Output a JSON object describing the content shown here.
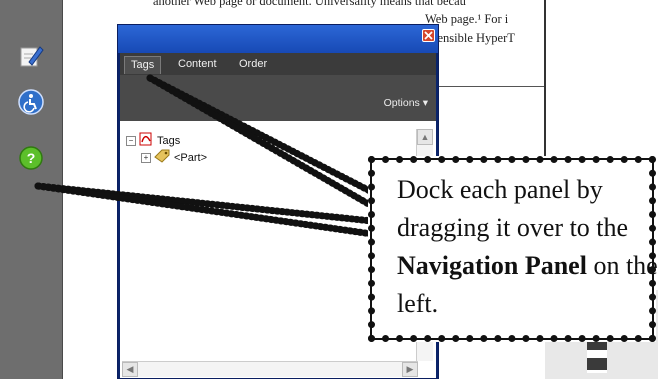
{
  "document": {
    "line1": "another Web page or document. Universality means that becau",
    "line2": "Web page.¹  For i",
    "line3": "Xtensible HyperT"
  },
  "nav_panel": {
    "buttons": [
      {
        "icon": "pen-edit-icon"
      },
      {
        "icon": "accessibility-icon"
      },
      {
        "icon": "help-icon"
      }
    ]
  },
  "tags_panel": {
    "tabs": [
      {
        "label": "Tags"
      },
      {
        "label": "Content"
      },
      {
        "label": "Order"
      }
    ],
    "active_tab": "Tags",
    "options_label": "Options ▾",
    "tree": {
      "root_label": "Tags",
      "child_label": "<Part>"
    },
    "colors": {
      "title_bar": "#1749b5",
      "tab_bar": "#3b3b3b",
      "close": "#d5472c"
    }
  },
  "callout": {
    "text_before": "Dock each panel by dragging it over to the ",
    "bold1": "Navigation Panel",
    "text_after": " on the left."
  }
}
